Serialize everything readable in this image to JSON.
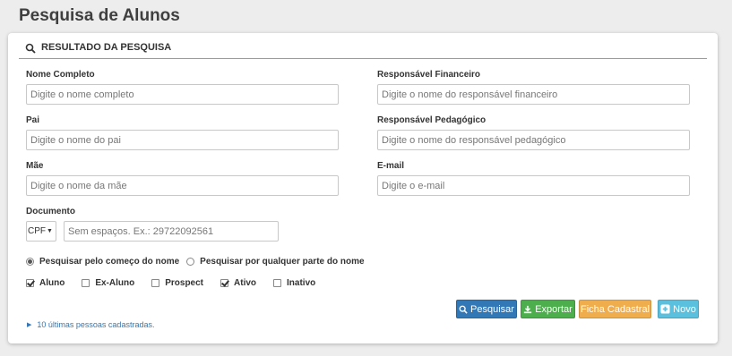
{
  "page": {
    "title": "Pesquisa de Alunos"
  },
  "panel": {
    "header": "RESULTADO DA PESQUISA"
  },
  "fields": {
    "nome": {
      "label": "Nome Completo",
      "placeholder": "Digite o nome completo"
    },
    "resp_fin": {
      "label": "Responsável Financeiro",
      "placeholder": "Digite o nome do responsável financeiro"
    },
    "pai": {
      "label": "Pai",
      "placeholder": "Digite o nome do pai"
    },
    "resp_ped": {
      "label": "Responsável Pedagógico",
      "placeholder": "Digite o nome do responsável pedagógico"
    },
    "mae": {
      "label": "Mãe",
      "placeholder": "Digite o nome da mãe"
    },
    "email": {
      "label": "E-mail",
      "placeholder": "Digite o e-mail"
    },
    "documento": {
      "label": "Documento",
      "type_value": "CPF",
      "placeholder": "Sem espaços. Ex.: 29722092561"
    }
  },
  "search_mode": {
    "options": [
      {
        "label": "Pesquisar pelo começo do nome",
        "selected": true
      },
      {
        "label": "Pesquisar por qualquer parte do nome",
        "selected": false
      }
    ]
  },
  "filters": [
    {
      "label": "Aluno",
      "checked": true
    },
    {
      "label": "Ex-Aluno",
      "checked": false
    },
    {
      "label": "Prospect",
      "checked": false
    },
    {
      "label": "Ativo",
      "checked": true
    },
    {
      "label": "Inativo",
      "checked": false
    }
  ],
  "buttons": {
    "pesquisar": "Pesquisar",
    "exportar": "Exportar",
    "ficha": "Ficha Cadastral",
    "novo": "Novo"
  },
  "recent_link": "10 últimas pessoas cadastradas.",
  "icons": {
    "header": "search-icon",
    "pesquisar": "search-icon",
    "exportar": "download-icon",
    "novo": "plus-icon",
    "recent": "caret-right-icon"
  },
  "colors": {
    "primary": "#3277b6",
    "success": "#4cae4c",
    "warning": "#f0ad4e",
    "info": "#5bc0de"
  }
}
